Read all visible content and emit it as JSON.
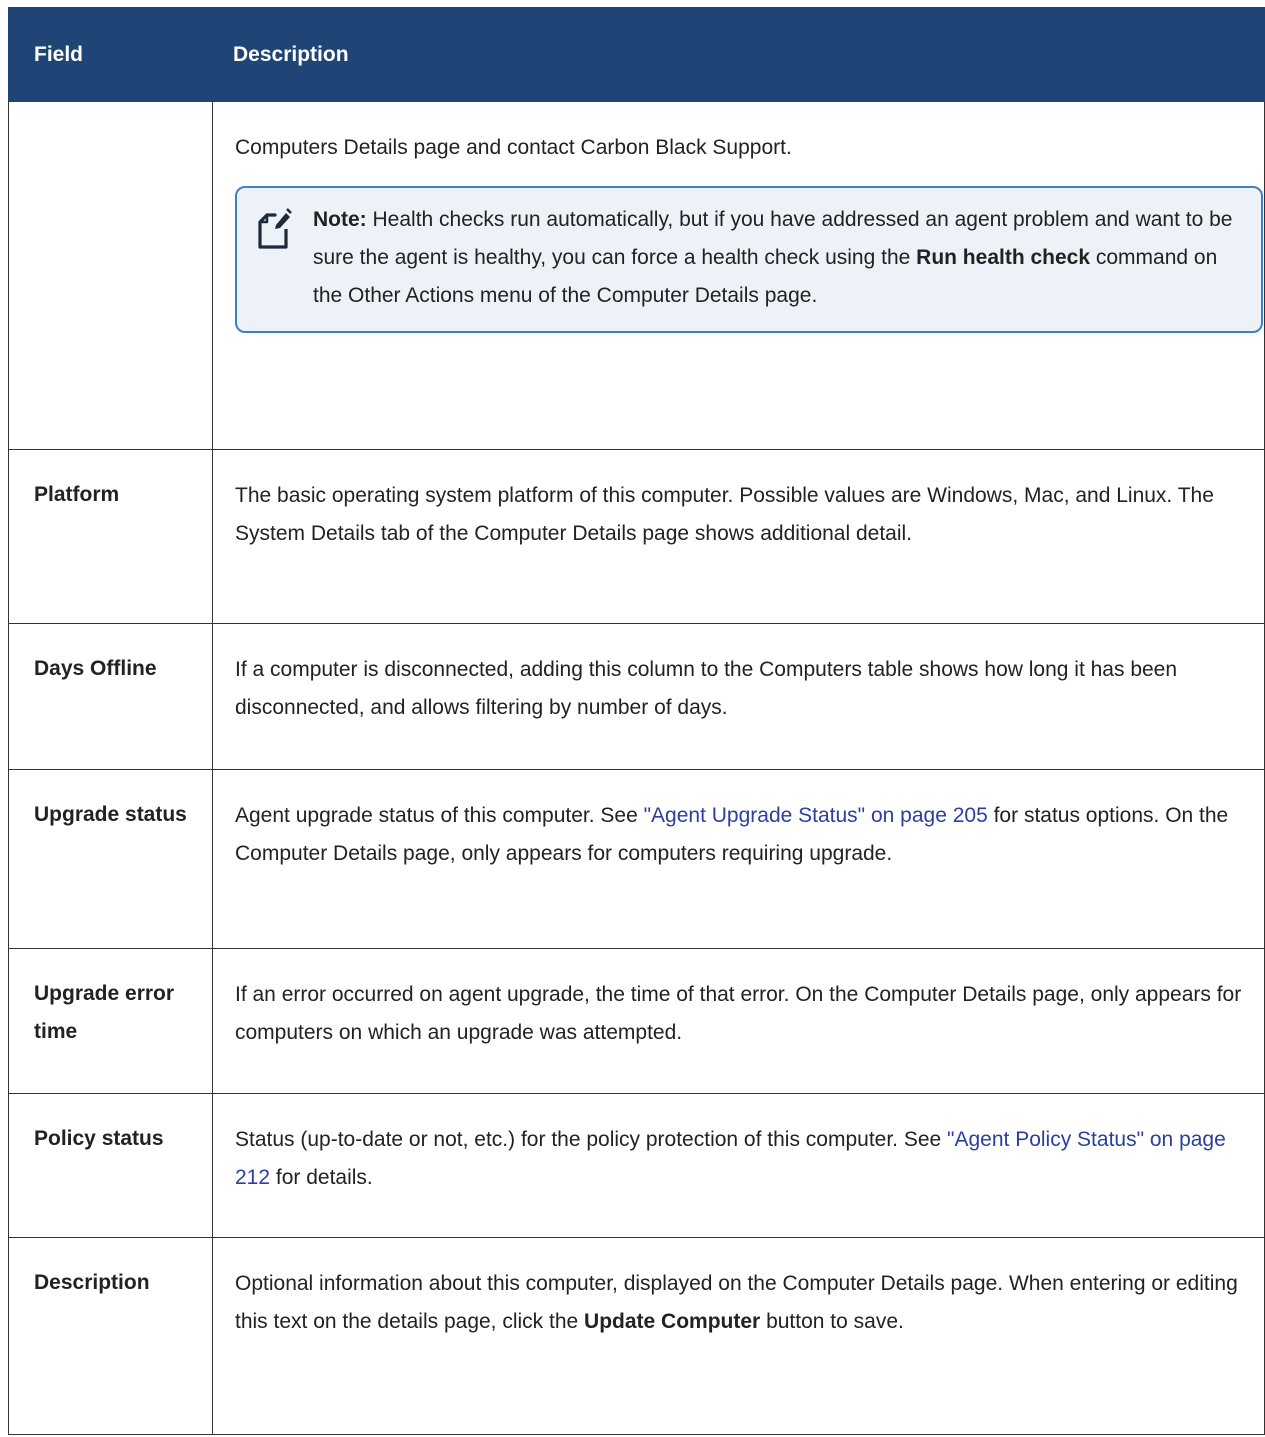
{
  "header": {
    "field": "Field",
    "description": "Description"
  },
  "row_continuation": {
    "text": "Computers Details page and contact Carbon Black Support.",
    "note": {
      "label": "Note:",
      "text_1": " Health checks run automatically, but if you have addressed an agent problem and want to be sure the agent is healthy, you can force a health check using the ",
      "bold": "Run health check",
      "text_2": " command on the Other Actions menu of the Computer Details page."
    }
  },
  "row_platform": {
    "field": "Platform",
    "text": "The basic operating system platform of this computer. Possible values are Windows, Mac, and Linux. The System Details tab of the Computer Details page shows additional detail."
  },
  "row_days_offline": {
    "field": "Days Offline",
    "text": "If a computer is disconnected, adding this column to the Computers table shows how long it has been disconnected, and allows filtering by number of days."
  },
  "row_upgrade_status": {
    "field": "Upgrade status",
    "text_1": "Agent upgrade status of this computer. See ",
    "link": "\"Agent Upgrade Status\" on page 205",
    "text_2": " for status options. On the Computer Details page, only appears for computers requiring upgrade."
  },
  "row_upgrade_error": {
    "field": "Upgrade error time",
    "text": "If an error occurred on agent upgrade, the time of that error. On the Computer Details page, only appears for computers on which an upgrade was attempted."
  },
  "row_policy_status": {
    "field": "Policy status",
    "text_1": "Status (up-to-date or not, etc.) for the policy protection of this computer. See ",
    "link": "\"Agent Policy Status\" on page 212",
    "text_2": " for details."
  },
  "row_description": {
    "field": "Description",
    "text_1": "Optional information about this computer, displayed on the Computer Details page. When entering or editing this text on the details page, click the ",
    "bold": "Update Computer",
    "text_2": " button to save."
  }
}
